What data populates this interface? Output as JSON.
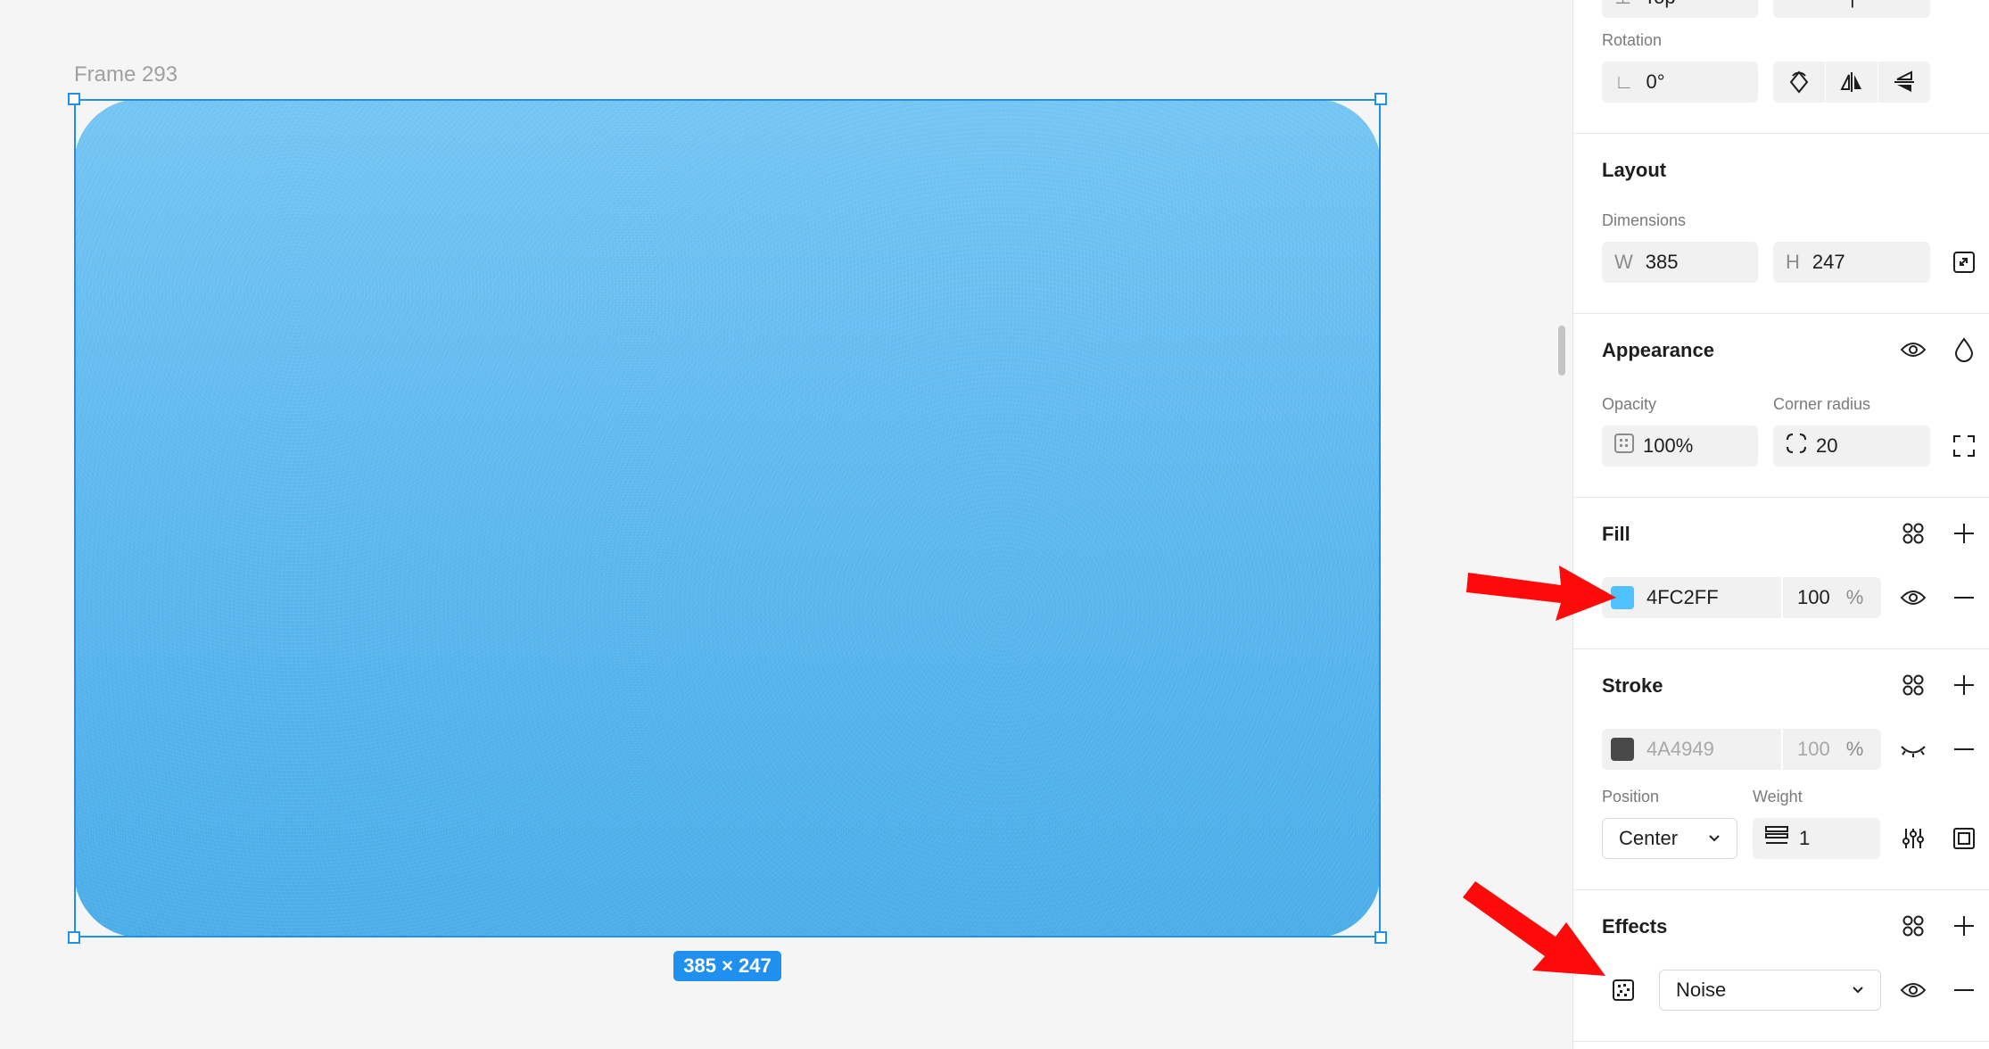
{
  "canvas": {
    "frame_label": "Frame 293",
    "size_badge": "385 × 247",
    "fill_color": "#4FC2FF"
  },
  "panel": {
    "top_partial": {
      "value": "Top"
    },
    "rotation": {
      "label": "Rotation",
      "value": "0°"
    },
    "layout": {
      "title": "Layout",
      "dimensions_label": "Dimensions",
      "w_prefix": "W",
      "w_value": "385",
      "h_prefix": "H",
      "h_value": "247"
    },
    "appearance": {
      "title": "Appearance",
      "opacity_label": "Opacity",
      "opacity_value": "100%",
      "radius_label": "Corner radius",
      "radius_value": "20"
    },
    "fill": {
      "title": "Fill",
      "hex": "4FC2FF",
      "opacity": "100",
      "percent": "%",
      "swatch_color": "#4FC2FF"
    },
    "stroke": {
      "title": "Stroke",
      "hex": "4A4949",
      "opacity": "100",
      "percent": "%",
      "swatch_color": "#4A4949",
      "position_label": "Position",
      "position_value": "Center",
      "weight_label": "Weight",
      "weight_value": "1"
    },
    "effects": {
      "title": "Effects",
      "effect_value": "Noise"
    }
  },
  "colors": {
    "accent": "#1F8FF0",
    "annotation_arrow": "#FF0A0A"
  }
}
